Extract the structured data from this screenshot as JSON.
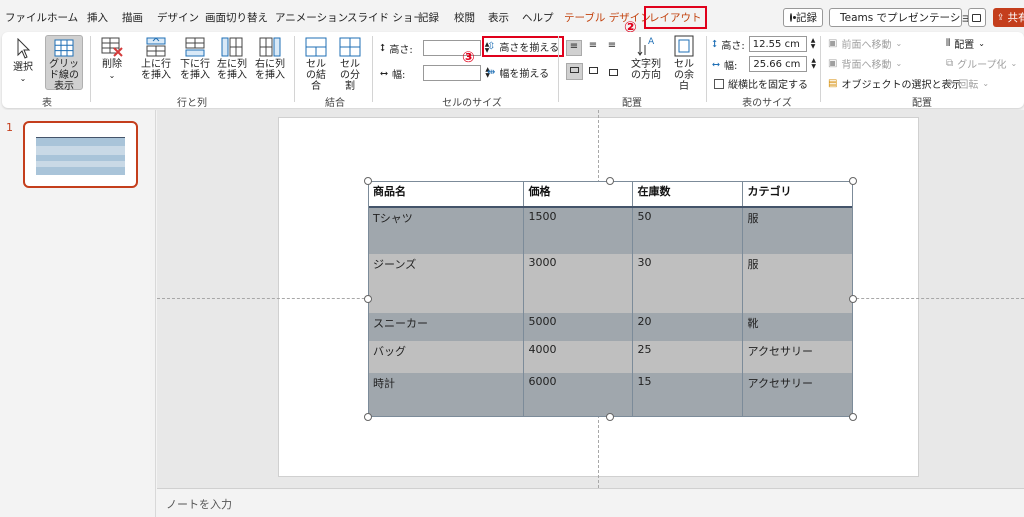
{
  "menu": {
    "tabs": [
      "ファイル",
      "ホーム",
      "挿入",
      "描画",
      "デザイン",
      "画面切り替え",
      "アニメーション",
      "スライド ショー",
      "記録",
      "校閲",
      "表示",
      "ヘルプ"
    ],
    "contextual_tab": "テーブル デザイン",
    "active_tab": "レイアウト",
    "record_button": "記録",
    "teams_button": "Teams でプレゼンテーション",
    "share_button": "共有"
  },
  "annotations": {
    "step2": "②",
    "step3": "③"
  },
  "ribbon": {
    "table_group": {
      "label": "表",
      "select": "選択",
      "gridlines": "グリッド線の表示"
    },
    "rows_cols_group": {
      "label": "行と列",
      "delete": "削除",
      "insert_above": "上に行を挿入",
      "insert_below": "下に行を挿入",
      "insert_left": "左に列を挿入",
      "insert_right": "右に列を挿入"
    },
    "merge_group": {
      "label": "結合",
      "merge": "セルの結合",
      "split": "セルの分割"
    },
    "cell_size_group": {
      "label": "セルのサイズ",
      "height_label": "高さ:",
      "width_label": "幅:",
      "height_value": "",
      "width_value": "",
      "distribute_rows": "高さを揃える",
      "distribute_cols": "幅を揃える"
    },
    "alignment_group": {
      "label": "配置",
      "text_direction": "文字列の方向",
      "cell_margins": "セルの余白"
    },
    "table_size_group": {
      "label": "表のサイズ",
      "height_label": "高さ:",
      "height_value": "12.55 cm",
      "width_label": "幅:",
      "width_value": "25.66 cm",
      "lock_aspect": "縦横比を固定する"
    },
    "arrange_group": {
      "label": "配置",
      "bring_forward": "前面へ移動",
      "send_backward": "背面へ移動",
      "selection_pane": "オブジェクトの選択と表示",
      "align": "配置",
      "group": "グループ化",
      "rotate": "回転"
    }
  },
  "thumbnail": {
    "slide_number": "1"
  },
  "table": {
    "headers": [
      "商品名",
      "価格",
      "在庫数",
      "カテゴリ"
    ],
    "rows": [
      [
        "Tシャツ",
        "1500",
        "50",
        "服"
      ],
      [
        "ジーンズ",
        "3000",
        "30",
        "服"
      ],
      [
        "スニーカー",
        "5000",
        "20",
        "靴"
      ],
      [
        "バッグ",
        "4000",
        "25",
        "アクセサリー"
      ],
      [
        "時計",
        "6000",
        "15",
        "アクセサリー"
      ]
    ]
  },
  "notes": {
    "placeholder": "ノートを入力"
  }
}
